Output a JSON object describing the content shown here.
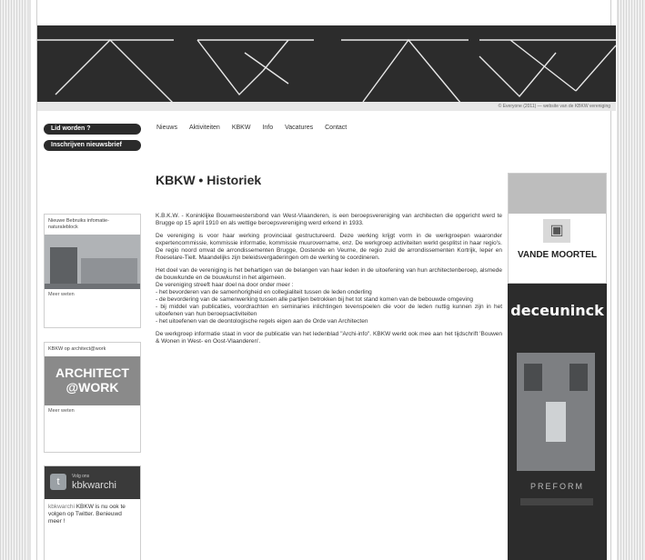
{
  "banner": {
    "caption": "© Everyone (2011) — website van de KBKW vereniging"
  },
  "sidebar": {
    "member_button": "Lid worden ?",
    "newsletter_button": "Inschrijven nieuwsbrief",
    "widget_1": {
      "title": "Nieuwe Bebruiks infomatie-naturaleblock",
      "more": "Meer weten"
    },
    "widget_2": {
      "title": "KBKW op architect@work",
      "logo_line1": "ARCHITECT",
      "logo_line2": "@WORK",
      "more": "Meer weten"
    },
    "twitter": {
      "brand_small": "Volg ons",
      "brand": "kbkwarchi",
      "handle": "kbkwarchi",
      "text": "KBKW is nu ook te volgen op Twitter. Benieuwd meer !",
      "bird": "t"
    }
  },
  "nav": {
    "items": [
      "Nieuws",
      "Aktiviteiten",
      "KBKW",
      "Info",
      "Vacatures",
      "Contact"
    ]
  },
  "main": {
    "title": "KBKW • Historiek",
    "p1": "K.B.K.W. - Koninklijke Bouwmeestersbond van West-Vlaanderen, is een beroepsvereniging van architecten die opgericht werd te Brugge op 15 april 1910 en als wettige beroepsvereniging werd erkend in 1933.",
    "p2": "De vereniging is voor haar werking provinciaal gestructureerd. Deze werking krijgt vorm in de werkgroepen waaronder expertencommissie, kommissie informatie, kommissie muurovername, enz. De werkgroep activiteiten werkt gesplitst in haar regio's. De regio noord omvat de arrondissementen Brugge, Oostende en Veurne, de regio zuid de arrondissementen Kortrijk, Ieper en Roeselare-Tielt. Maandelijks zijn beleidsvergaderingen om de werking te coordineren.",
    "p3_intro": "Het doel van de vereniging is het behartigen van de belangen van haar leden in de uitoefening van hun architectenberoep, alsmede de bouwkunde en de bouwkunst in het algemeen.",
    "p3_lead": "De vereniging streeft haar doel na door onder meer :",
    "bullets": [
      "- het bevorderen van de samenhorigheid en collegialiteit tussen de leden onderling",
      "- de bevordering van de samenwerking tussen alle partijen betrokken bij het tot stand komen van de bebouwde omgeving",
      "- bij middel van publicaties, voordrachten en seminaries inlichtingen tevenspoelen die voor de leden nuttig kunnen zijn in het uitoefenen van hun beroepsactiviteiten",
      "- het uitoefenen van de deontologische regels eigen aan de Orde van Architecten"
    ],
    "p4": "De werkgroep informatie staat in voor de publicatie van het ledenblad \"Archi-info\". KBKW werkt ook mee aan het tijdschrift 'Bouwen & Wonen in West- en Oost-Vlaanderen'."
  },
  "ads": {
    "vandemoortel": "VANDE MOORTEL",
    "deceuninck": "deceuninck",
    "product": "PREFORM"
  }
}
